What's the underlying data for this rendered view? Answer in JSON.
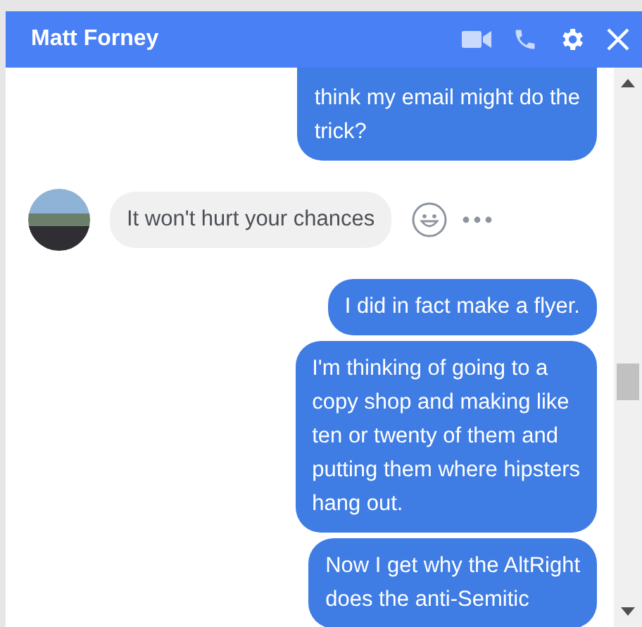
{
  "header": {
    "title": "Matt Forney"
  },
  "messages": [
    {
      "kind": "outgoing",
      "cut_top": true,
      "text": "think my email might do the\ntrick?"
    },
    {
      "kind": "incoming",
      "cut_top": false,
      "text": "It won't hurt your chances"
    },
    {
      "kind": "outgoing",
      "cut_top": false,
      "text": "I did in fact make a flyer."
    },
    {
      "kind": "outgoing",
      "cut_top": false,
      "text": "I'm thinking of going to a\ncopy shop and making like\nten or twenty of them and\nputting them where hipsters\nhang out."
    },
    {
      "kind": "outgoing",
      "cut_top": false,
      "text": "Now I get why the AltRight\ndoes the anti-Semitic"
    }
  ]
}
